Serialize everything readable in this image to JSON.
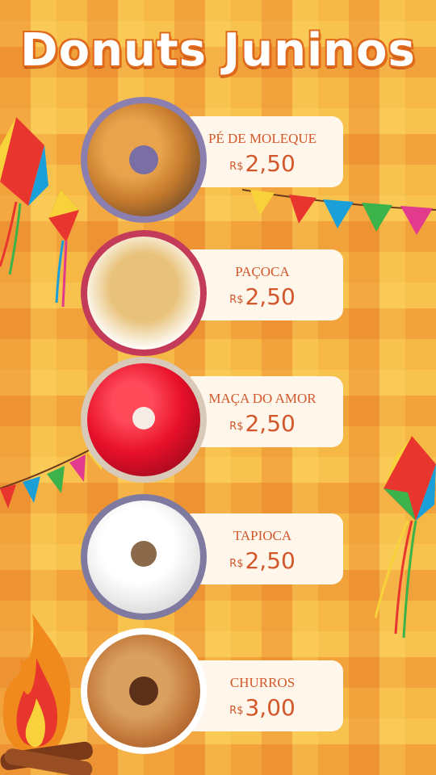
{
  "title": "Donuts Juninos",
  "currency": "R$",
  "items": [
    {
      "name": "PÉ DE MOLEQUE",
      "price": "2,50"
    },
    {
      "name": "PAÇOCA",
      "price": "2,50"
    },
    {
      "name": "MAÇA DO AMOR",
      "price": "2,50"
    },
    {
      "name": "TAPIOCA",
      "price": "2,50"
    },
    {
      "name": "CHURROS",
      "price": "3,00"
    }
  ],
  "colors": {
    "background": "#F6B844",
    "accent": "#D2572A",
    "card": "#FFF7EC"
  }
}
